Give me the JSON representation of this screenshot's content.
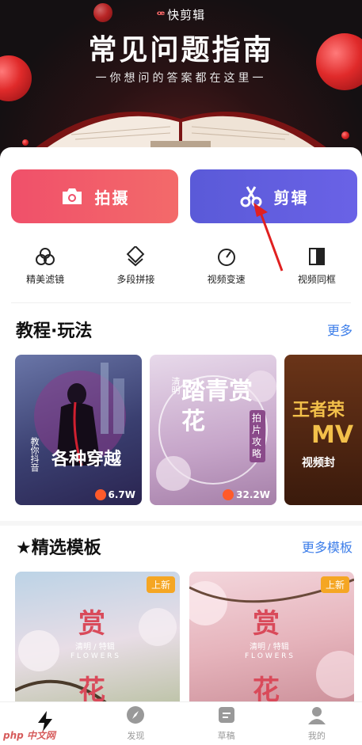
{
  "banner": {
    "logo_text": "快剪辑",
    "title": "常见问题指南",
    "subtitle": "一你想问的答案都在这里一"
  },
  "actions": {
    "shoot_label": "拍摄",
    "edit_label": "剪辑"
  },
  "tools": [
    {
      "label": "精美滤镜",
      "icon": "filter-icon"
    },
    {
      "label": "多段拼接",
      "icon": "splice-icon"
    },
    {
      "label": "视频变速",
      "icon": "speed-icon"
    },
    {
      "label": "视频同框",
      "icon": "split-frame-icon"
    }
  ],
  "tutorials": {
    "title": "教程·玩法",
    "more": "更多",
    "cards": [
      {
        "text_small": "教你抖音",
        "text_big": "各种穿越",
        "views": "6.7W"
      },
      {
        "text_small": "清明",
        "text_big": "踏青赏花",
        "tag": "拍片攻略",
        "views": "32.2W"
      },
      {
        "text_big": "王者荣",
        "text_mid": "MV",
        "text_small": "视频封"
      }
    ]
  },
  "templates": {
    "title": "★精选模板",
    "more": "更多模板",
    "items": [
      {
        "badge": "上新",
        "text_top": "赏",
        "text_sub": "清明 / 特辑",
        "text_en": "F L O W E R S",
        "text_bottom": "花"
      },
      {
        "badge": "上新",
        "text_top": "赏",
        "text_sub": "清明 / 特辑",
        "text_en": "F L O W E R S",
        "text_bottom": "花"
      }
    ]
  },
  "nav": [
    {
      "label": "",
      "icon": "lightning-icon",
      "active": true
    },
    {
      "label": "发现",
      "icon": "compass-icon"
    },
    {
      "label": "草稿",
      "icon": "draft-icon"
    },
    {
      "label": "我的",
      "icon": "user-icon"
    }
  ],
  "watermark": "php 中文网",
  "colors": {
    "shoot": "#f0506a",
    "edit": "#5a5ad8",
    "link": "#3d7ee9",
    "badge": "#f5a623"
  }
}
